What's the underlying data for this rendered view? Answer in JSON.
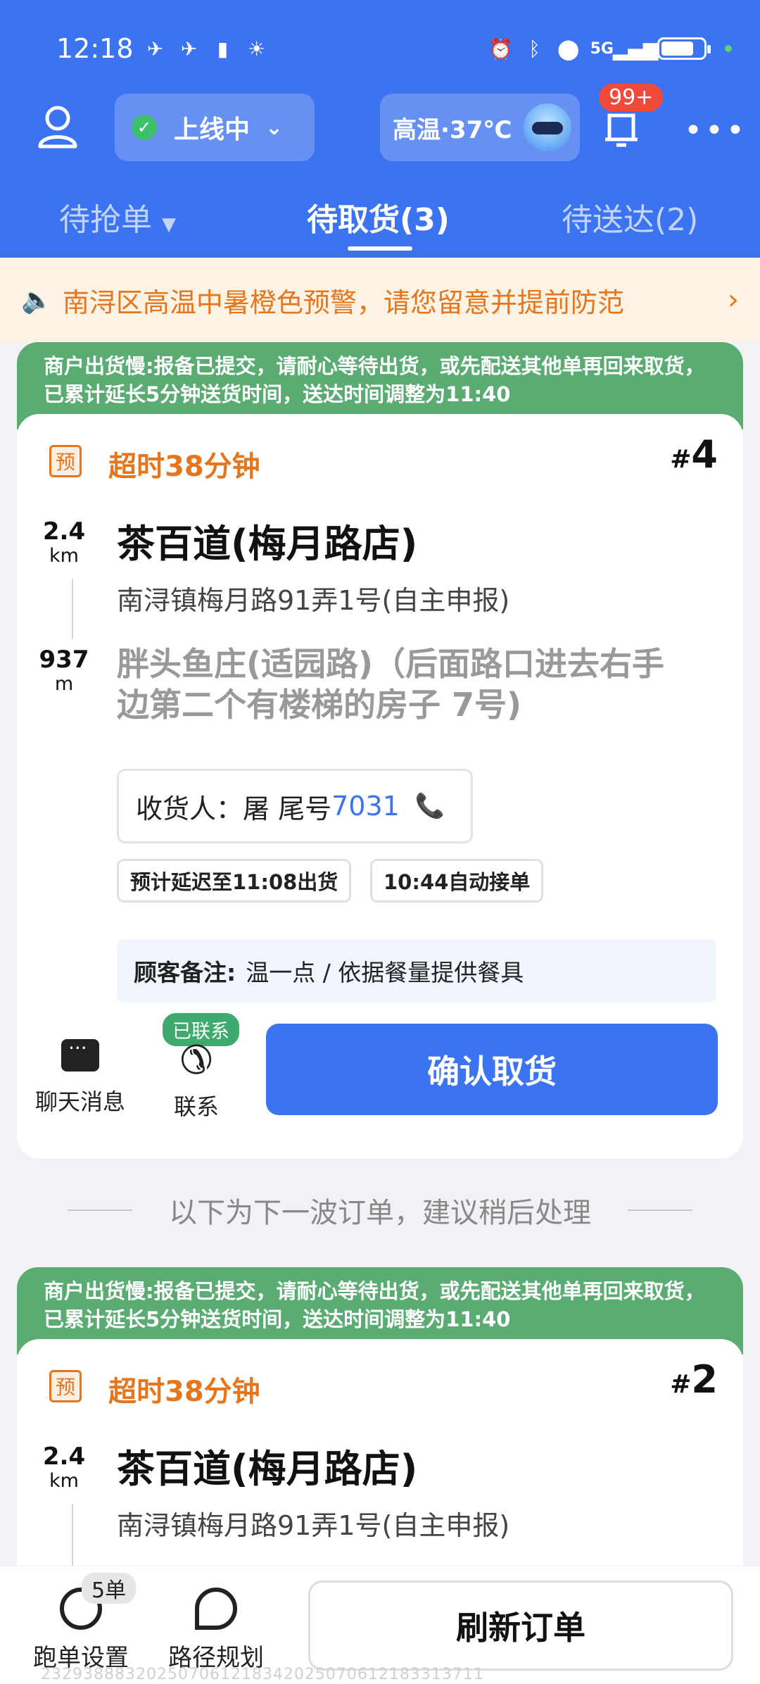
{
  "status_bar": {
    "time": "12:18",
    "network": "5G"
  },
  "header": {
    "online_status": "上线中",
    "weather": "高温·37℃",
    "notification_badge": "99+",
    "tabs": [
      {
        "label": "待抢单",
        "active": false
      },
      {
        "label": "待取货(3)",
        "active": true
      },
      {
        "label": "待送达(2)",
        "active": false
      }
    ]
  },
  "alert": {
    "text": "南浔区高温中暑橙色预警，请您留意并提前防范"
  },
  "orders": [
    {
      "notice": "商户出货慢:报备已提交，请耐心等待出货，或先配送其他单再回来取货，已累计延长5分钟送货时间，送达时间调整为11:40",
      "pre_tag": "预",
      "overtime": "超时38分钟",
      "number_prefix": "#",
      "number": "4",
      "pickup_distance": "2.4",
      "pickup_unit": "km",
      "shop_name": "茶百道(梅月路店)",
      "shop_address": "南浔镇梅月路91弄1号(自主申报)",
      "delivery_distance": "937",
      "delivery_unit": "m",
      "destination": "胖头鱼庄(适园路)（后面路口进去右手边第二个有楼梯的房子 7号)",
      "receiver_label": "收货人：屠 尾号",
      "receiver_phone": "7031",
      "chip_delay": "预计延迟至11:08出货",
      "chip_auto": "10:44自动接单",
      "remark_label": "顾客备注:",
      "remark_text": "温一点 / 依据餐量提供餐具",
      "chat_label": "聊天消息",
      "contact_label": "联系",
      "contacted_badge": "已联系",
      "confirm_label": "确认取货"
    },
    {
      "notice": "商户出货慢:报备已提交，请耐心等待出货，或先配送其他单再回来取货，已累计延长5分钟送货时间，送达时间调整为11:40",
      "pre_tag": "预",
      "overtime": "超时38分钟",
      "number_prefix": "#",
      "number": "2",
      "pickup_distance": "2.4",
      "pickup_unit": "km",
      "shop_name": "茶百道(梅月路店)",
      "shop_address": "南浔镇梅月路91弄1号(自主申报)"
    }
  ],
  "divider": "以下为下一波订单，建议稍后处理",
  "bottom_bar": {
    "settings_label": "跑单设置",
    "settings_badge": "5单",
    "route_label": "路径规划",
    "refresh_label": "刷新订单",
    "footer_id": "232938883202507061218342025070612183313711"
  },
  "colors": {
    "brand_blue": "#3b73f0",
    "notice_green": "#5aac73",
    "warning_orange": "#e5761e"
  }
}
